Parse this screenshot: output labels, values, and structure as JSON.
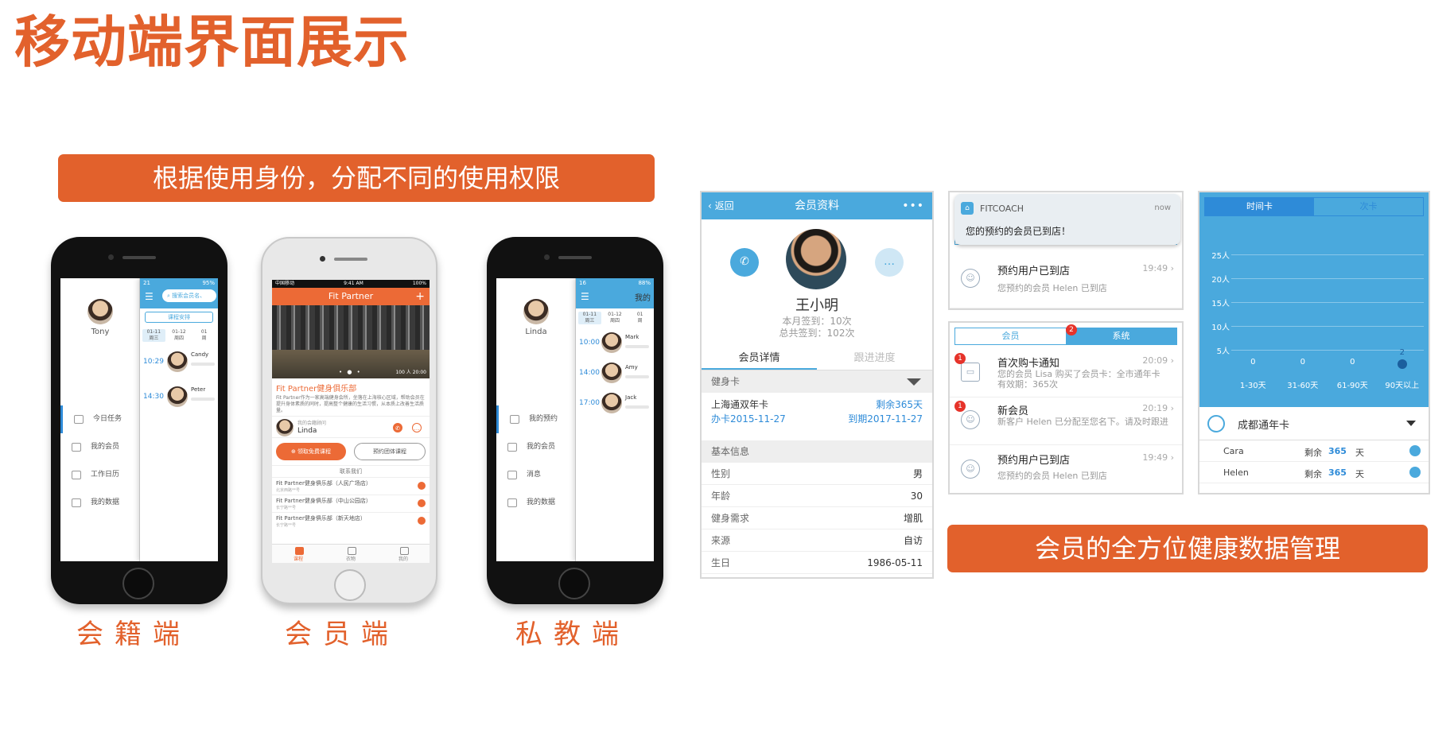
{
  "title": "移动端界面展示",
  "banner_left": "根据使用身份，分配不同的使用权限",
  "banner_right": "会员的全方位健康数据管理",
  "captions": [
    "会籍端",
    "会员端",
    "私教端"
  ],
  "colors": {
    "accent": "#e2612c",
    "blue": "#4aa9dd"
  },
  "sales_phone": {
    "status": "21",
    "battery": "95%",
    "user": "Tony",
    "search_placeholder": "搜索会员名、",
    "course_btn": "课程安排",
    "dates": [
      {
        "d": "01-11",
        "w": "周三"
      },
      {
        "d": "01-12",
        "w": "周四"
      },
      {
        "d": "01",
        "w": "周"
      }
    ],
    "menu": [
      "今日任务",
      "我的会员",
      "工作日历",
      "我的数据"
    ],
    "slots": [
      {
        "time": "10:29",
        "name": "Candy"
      },
      {
        "time": "14:30",
        "name": "Peter"
      }
    ]
  },
  "member_phone": {
    "carrier": "中国移动",
    "time": "9:41 AM",
    "battery": "100%",
    "app_title": "Fit Partner",
    "plus": "+",
    "slide_dots": "• ● •",
    "visitors": "100 人 20:00",
    "club_name": "Fit Partner健身俱乐部",
    "club_desc": "Fit Partner作为一家高端健身会所，坐落在上海核心区域，帮助会员在提升身体素质的同时，提高整个健康的生活习惯，从本质上改善生活质量。",
    "advisor_label": "我的会籍顾问",
    "advisor_name": "Linda",
    "btn_free": "⊕ 领取免费课程",
    "btn_group": "预约团体课程",
    "contact": "联系我们",
    "branches": [
      {
        "name": "Fit Partner健身俱乐部（人民广场店）",
        "addr": "北京西路**号"
      },
      {
        "name": "Fit Partner健身俱乐部（中山公园店）",
        "addr": "长宁路**号"
      },
      {
        "name": "Fit Partner健身俱乐部（新天地店）",
        "addr": "长宁路**号"
      }
    ],
    "tabs": [
      "课程",
      "衣物",
      "我的"
    ]
  },
  "coach_phone": {
    "status": "16",
    "battery": "88%",
    "user": "Linda",
    "header": "我的",
    "dates": [
      {
        "d": "01-11",
        "w": "周三"
      },
      {
        "d": "01-12",
        "w": "周四"
      },
      {
        "d": "01",
        "w": "周"
      }
    ],
    "menu": [
      "我的预约",
      "我的会员",
      "消息",
      "我的数据"
    ],
    "slots": [
      {
        "time": "10:00",
        "name": "Mark"
      },
      {
        "time": "14:00",
        "name": "Amy"
      },
      {
        "time": "17:00",
        "name": "Jack"
      }
    ]
  },
  "profile_card": {
    "back": "返回",
    "title": "会员资料",
    "more": "•••",
    "name": "王小明",
    "month_checkin": "本月签到：10次",
    "total_checkin": "总共签到：102次",
    "tab_detail": "会员详情",
    "tab_progress": "跟进进度",
    "sec_card": "健身卡",
    "card_name": "上海通双年卡",
    "card_remain": "剩余365天",
    "card_open": "办卡2015-11-27",
    "card_expire": "到期2017-11-27",
    "sec_info": "基本信息",
    "fields": [
      {
        "k": "性别",
        "v": "男"
      },
      {
        "k": "年龄",
        "v": "30"
      },
      {
        "k": "健身需求",
        "v": "增肌"
      },
      {
        "k": "来源",
        "v": "自访"
      },
      {
        "k": "生日",
        "v": "1986-05-11"
      }
    ]
  },
  "notify_card": {
    "app": "FITCOACH",
    "time": "now",
    "message": "您的预约的会员已到店！",
    "seg_member": "会员",
    "seg_system": "系统",
    "item_title": "预约用户已到店",
    "item_time": "19:49",
    "item_desc": "您预约的会员 Helen 已到店"
  },
  "messages_card": {
    "seg_member": "会员",
    "seg_system": "系统",
    "system_badge": "2",
    "items": [
      {
        "badge": "1",
        "title": "首次购卡通知",
        "time": "20:09",
        "desc": "您的会员 Lisa 购买了会员卡：全市通年卡 有效期：365次"
      },
      {
        "badge": "1",
        "title": "新会员",
        "time": "20:19",
        "desc": "新客户 Helen 已分配至您名下。请及时跟进"
      },
      {
        "badge": "",
        "title": "预约用户已到店",
        "time": "19:49",
        "desc": "您预约的会员 Helen 已到店"
      }
    ]
  },
  "stats_card": {
    "tab_time": "时间卡",
    "tab_count": "次卡",
    "card_name": "成都通年卡",
    "rows": [
      {
        "name": "Cara",
        "remain": "剩余",
        "days": "365",
        "unit": "天"
      },
      {
        "name": "Helen",
        "remain": "剩余",
        "days": "365",
        "unit": "天"
      }
    ]
  },
  "chart_data": {
    "type": "scatter",
    "categories": [
      "1-30天",
      "31-60天",
      "61-90天",
      "90天以上"
    ],
    "values": [
      0,
      0,
      0,
      2
    ],
    "yticks": [
      "25人",
      "20人",
      "15人",
      "10人",
      "5人"
    ],
    "ylim": [
      0,
      25
    ],
    "grid": true
  }
}
